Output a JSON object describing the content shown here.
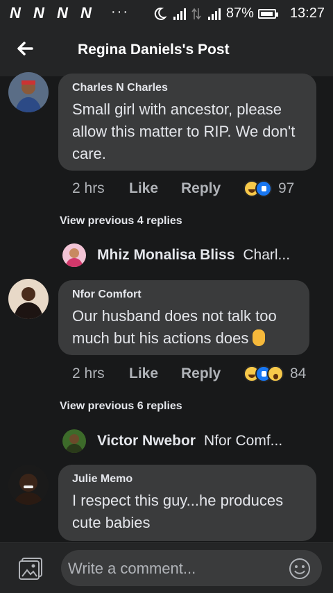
{
  "status_bar": {
    "carrier_icons": "N N N N",
    "dots": "···",
    "signal1": "ᵍ",
    "signal2": "⁴ᴳ",
    "battery_pct": "87%",
    "time": "13:27"
  },
  "header": {
    "title": "Regina Daniels's Post"
  },
  "comments": [
    {
      "name": "Charles N Charles",
      "text": "Small girl with ancestor, please allow this matter to RIP. We don't care.",
      "time": "2 hrs",
      "like": "Like",
      "reply": "Reply",
      "reactions": [
        "haha",
        "like"
      ],
      "count": "97",
      "view_previous": "View previous 4 replies",
      "reply_preview": {
        "name": "Mhiz Monalisa Bliss",
        "text": "Charl..."
      }
    },
    {
      "name": "Nfor Comfort",
      "text": "Our husband does not talk too much but his actions does",
      "time": "2 hrs",
      "like": "Like",
      "reply": "Reply",
      "reactions": [
        "haha",
        "like",
        "wow"
      ],
      "count": "84",
      "view_previous": "View previous 6 replies",
      "reply_preview": {
        "name": "Victor Nwebor",
        "text": "Nfor Comf..."
      }
    },
    {
      "name": "Julie Memo",
      "text": "I respect this guy...he produces cute babies"
    }
  ],
  "composer": {
    "placeholder": "Write a comment..."
  },
  "colors": {
    "background": "#18191a",
    "bubble": "#3a3b3c",
    "bar": "#242526",
    "muted": "#b0b3b8"
  }
}
